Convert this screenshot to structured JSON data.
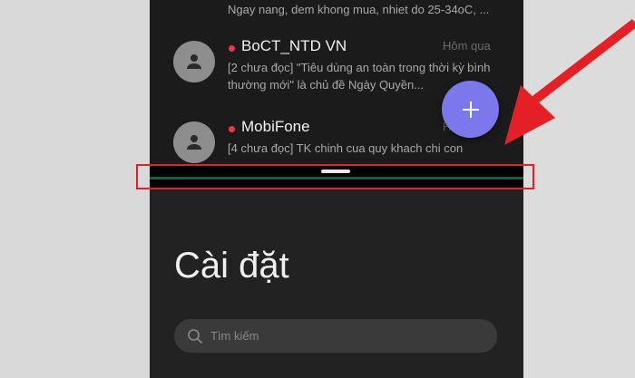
{
  "conversations": {
    "top_snippet": "Ngay nang, dem khong mua, nhiet do 25-34oC, ...",
    "items": [
      {
        "sender": "BoCT_NTD VN",
        "time": "Hôm qua",
        "preview": "[2 chưa đọc] \"Tiêu dùng an toàn trong thời kỳ bình thường mới\" là chủ đề Ngày Quyền..."
      },
      {
        "sender": "MobiFone",
        "time": "Hôm qua",
        "preview": "[4 chưa đọc] TK chinh cua quy khach chi con"
      }
    ]
  },
  "settings": {
    "title": "Cài đặt",
    "search_placeholder": "Tìm kiếm"
  },
  "colors": {
    "unread_dot": "#e53b4e",
    "fab": "#7a78ea",
    "annotation_red": "#e41f25",
    "divider_green": "#1e5c48"
  },
  "icons": {
    "avatar": "person-icon",
    "fab": "plus-icon",
    "search": "search-icon",
    "annotation": "red-arrow"
  }
}
